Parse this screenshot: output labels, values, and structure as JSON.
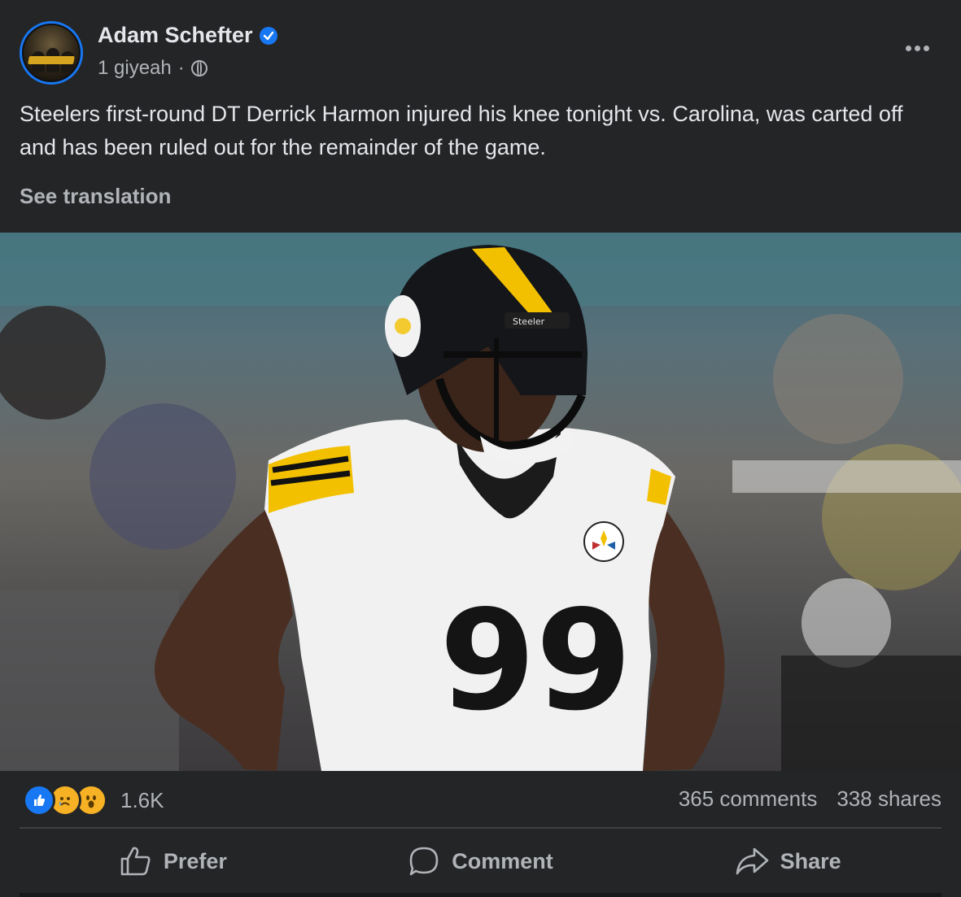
{
  "post": {
    "author": "Adam Schefter",
    "time": "1 giyeah",
    "separator": "·",
    "text": "Steelers first-round DT Derrick Harmon injured his knee tonight vs. Carolina, was carted off and has been ruled out for the remainder of the game.",
    "see_translation": "See translation"
  },
  "photo": {
    "jersey_number": "99",
    "helmet_label": "Steeler"
  },
  "stats": {
    "reaction_count": "1.6K",
    "comments": "365 comments",
    "shares": "338 shares",
    "reactions": [
      "like-icon",
      "sad-icon",
      "wow-icon"
    ]
  },
  "actions": {
    "like_label": "Prefer",
    "comment_label": "Comment",
    "share_label": "Share"
  },
  "colors": {
    "background": "#242526",
    "text_primary": "#e4e6eb",
    "text_secondary": "#b0b3b8",
    "accent": "#1877f2",
    "steelers_gold": "#f3c000"
  }
}
